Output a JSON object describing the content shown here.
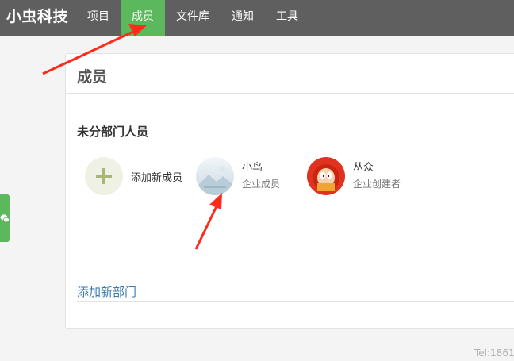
{
  "header": {
    "brand": "小虫科技",
    "nav": [
      {
        "label": "项目",
        "active": false
      },
      {
        "label": "成员",
        "active": true
      },
      {
        "label": "文件库",
        "active": false
      },
      {
        "label": "通知",
        "active": false
      },
      {
        "label": "工具",
        "active": false
      }
    ]
  },
  "side_tab": {
    "icon": "wechat-icon"
  },
  "panel": {
    "title": "成员",
    "section_title": "未分部门人员",
    "add_member_label": "添加新成员",
    "members": [
      {
        "name": "小鸟",
        "role": "企业成员",
        "avatar": "placeholder-image-avatar"
      },
      {
        "name": "丛众",
        "role": "企业创建者",
        "avatar": "cartoon-avatar"
      }
    ],
    "add_department_label": "添加新部门"
  },
  "footer": {
    "tel": "Tel:1861"
  },
  "colors": {
    "topbar": "#5f5f5f",
    "active_nav": "#5cb85c",
    "link": "#3a7bb0",
    "annotation_arrow": "#ff2a1a"
  }
}
